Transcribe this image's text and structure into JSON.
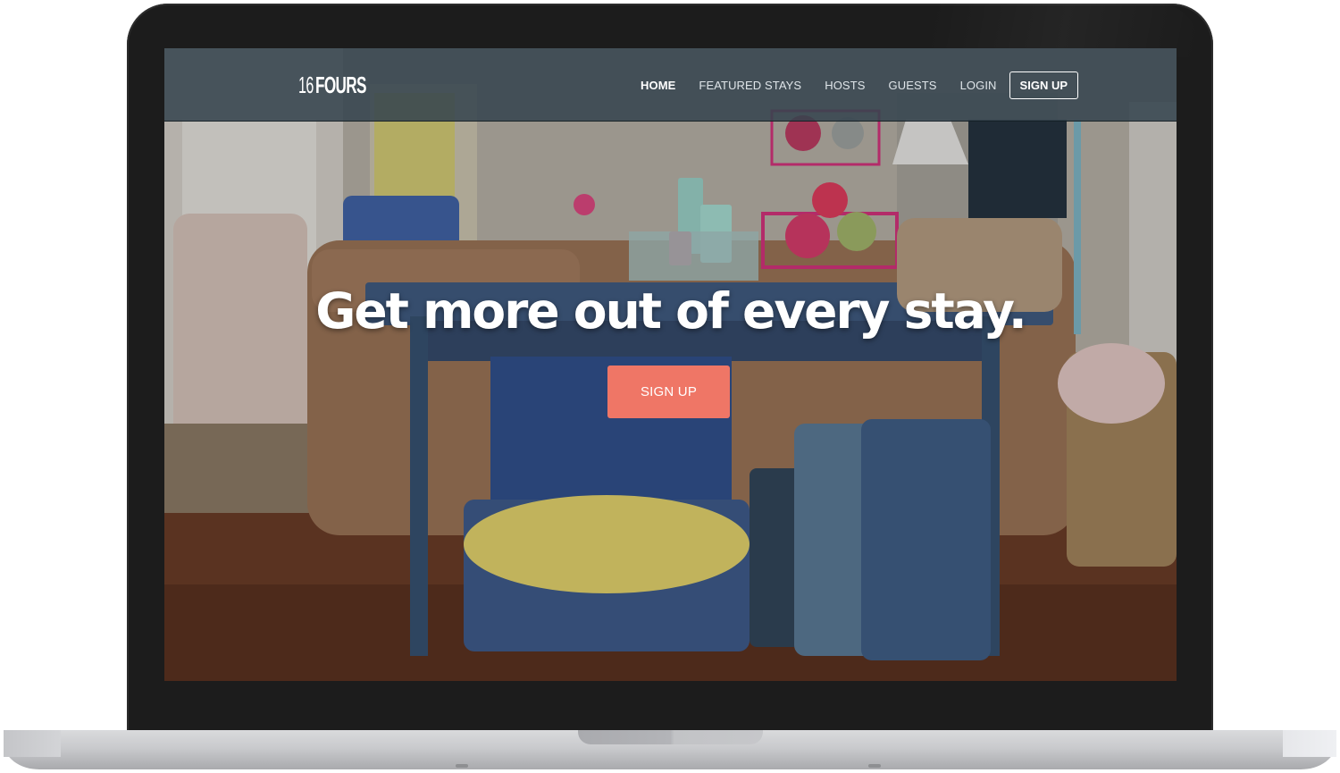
{
  "navbar": {
    "brand_num": "16",
    "brand_word": "FOURS",
    "links": [
      {
        "label": "HOME"
      },
      {
        "label": "FEATURED STAYS"
      },
      {
        "label": "HOSTS"
      },
      {
        "label": "GUESTS"
      },
      {
        "label": "LOGIN"
      }
    ],
    "signup_label": "SIGN UP"
  },
  "hero": {
    "headline": "Get more out of every stay.",
    "cta_label": "SIGN UP"
  },
  "colors": {
    "navbar_bg": "#34444e",
    "cta_bg": "#ef7666",
    "bezel": "#1c1c1c",
    "laptop_base": "#c9cacd"
  },
  "background_image": "living room with blue table and vintage suitcases"
}
